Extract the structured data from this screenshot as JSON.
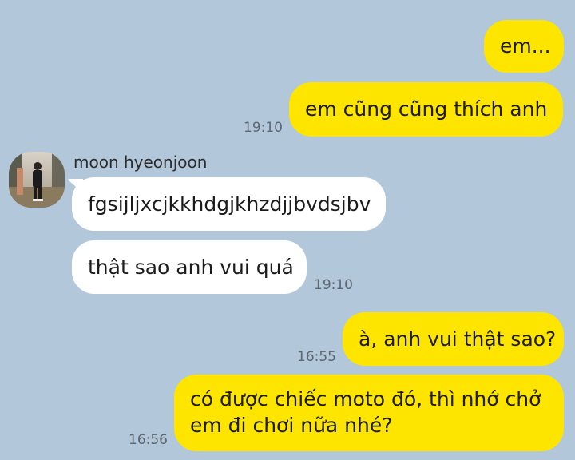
{
  "conversation": {
    "background_color": "#b2c7da",
    "outgoing_bubble_color": "#fee500",
    "incoming_bubble_color": "#ffffff",
    "messages": [
      {
        "text": "em...",
        "time": ""
      },
      {
        "text": "em cũng cũng thích anh",
        "time": "19:10"
      },
      {
        "sender": "moon hyeonjoon",
        "text": "fgsijljxcjkkhdgjkhzdjjbvdsjbv",
        "time": ""
      },
      {
        "text": "thật sao anh vui quá",
        "time": "19:10"
      },
      {
        "text": "à, anh vui thật sao?",
        "time": "16:55"
      },
      {
        "text_line1": "có được chiếc moto đó, thì nhớ chở",
        "text_line2": "em đi chơi nữa nhé?",
        "time": "16:56"
      }
    ]
  },
  "contact": {
    "name": "moon hyeonjoon",
    "avatar_icon": "profile-photo-icon"
  }
}
